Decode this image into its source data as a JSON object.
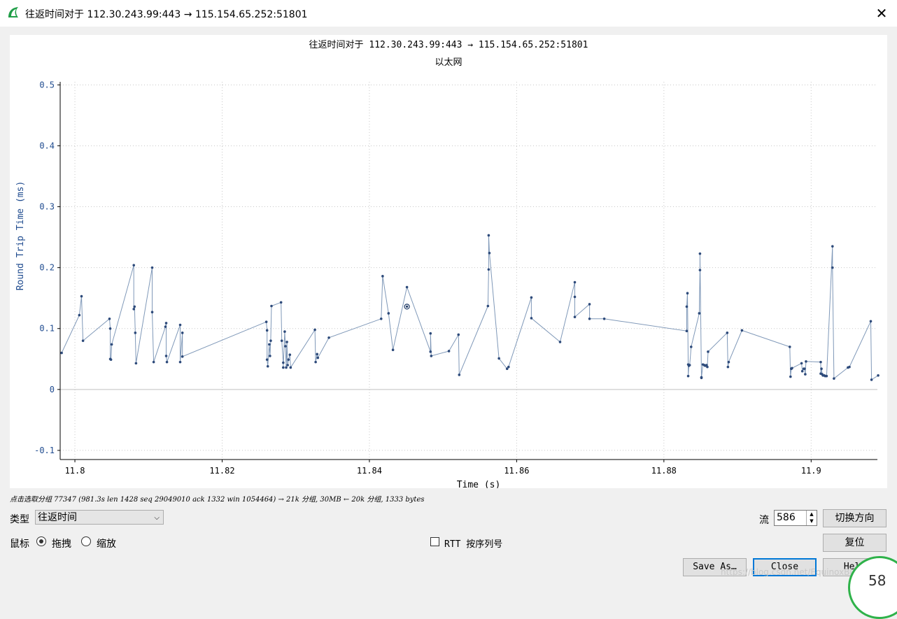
{
  "window": {
    "title": "往返时间对于 112.30.243.99:443 → 115.154.65.252:51801",
    "close_glyph": "✕",
    "icon": "wireshark-fin-icon"
  },
  "chart_data": {
    "type": "scatter",
    "title": "往返时间对于 112.30.243.99:443 → 115.154.65.252:51801",
    "subtitle": "以太网",
    "xlabel": "Time (s)",
    "ylabel": "Round Trip Time (ms)",
    "xlim": [
      11.798,
      11.909
    ],
    "ylim": [
      -0.115,
      0.505
    ],
    "xticks": [
      11.8,
      11.82,
      11.84,
      11.86,
      11.88,
      11.9
    ],
    "xtick_labels": [
      "11.8",
      "11.82",
      "11.84",
      "11.86",
      "11.88",
      "11.9"
    ],
    "yticks": [
      -0.1,
      0,
      0.1,
      0.2,
      0.3,
      0.4,
      0.5
    ],
    "ytick_labels": [
      "-0.1",
      "0",
      "0.1",
      "0.2",
      "0.3",
      "0.4",
      "0.5"
    ],
    "grid": true,
    "line_color": "#7f98b8",
    "marker_color": "#2d4a7a",
    "selected_point": [
      11.8451,
      0.136
    ],
    "points": [
      [
        11.7982,
        0.06
      ],
      [
        11.8006,
        0.122
      ],
      [
        11.8009,
        0.153
      ],
      [
        11.8011,
        0.08
      ],
      [
        11.8047,
        0.116
      ],
      [
        11.8048,
        0.1
      ],
      [
        11.8048,
        0.05
      ],
      [
        11.8049,
        0.049
      ],
      [
        11.805,
        0.074
      ],
      [
        11.808,
        0.204
      ],
      [
        11.808,
        0.132
      ],
      [
        11.8081,
        0.136
      ],
      [
        11.8082,
        0.093
      ],
      [
        11.8083,
        0.043
      ],
      [
        11.8105,
        0.2
      ],
      [
        11.8105,
        0.127
      ],
      [
        11.8107,
        0.045
      ],
      [
        11.8123,
        0.103
      ],
      [
        11.8124,
        0.109
      ],
      [
        11.8124,
        0.055
      ],
      [
        11.8125,
        0.045
      ],
      [
        11.8143,
        0.106
      ],
      [
        11.8143,
        0.045
      ],
      [
        11.8146,
        0.093
      ],
      [
        11.8146,
        0.054
      ],
      [
        11.826,
        0.111
      ],
      [
        11.8261,
        0.097
      ],
      [
        11.8261,
        0.049
      ],
      [
        11.8262,
        0.038
      ],
      [
        11.8264,
        0.074
      ],
      [
        11.8265,
        0.055
      ],
      [
        11.8266,
        0.08
      ],
      [
        11.8267,
        0.137
      ],
      [
        11.828,
        0.143
      ],
      [
        11.8281,
        0.08
      ],
      [
        11.8283,
        0.044
      ],
      [
        11.8283,
        0.036
      ],
      [
        11.8285,
        0.095
      ],
      [
        11.8286,
        0.071
      ],
      [
        11.8287,
        0.036
      ],
      [
        11.8288,
        0.078
      ],
      [
        11.8289,
        0.04
      ],
      [
        11.829,
        0.049
      ],
      [
        11.8292,
        0.057
      ],
      [
        11.8293,
        0.036
      ],
      [
        11.8326,
        0.098
      ],
      [
        11.8327,
        0.045
      ],
      [
        11.8329,
        0.058
      ],
      [
        11.833,
        0.052
      ],
      [
        11.8345,
        0.085
      ],
      [
        11.8416,
        0.116
      ],
      [
        11.8418,
        0.186
      ],
      [
        11.8426,
        0.125
      ],
      [
        11.8432,
        0.065
      ],
      [
        11.8451,
        0.168
      ],
      [
        11.8483,
        0.062
      ],
      [
        11.8483,
        0.092
      ],
      [
        11.8484,
        0.055
      ],
      [
        11.8508,
        0.063
      ],
      [
        11.8521,
        0.09
      ],
      [
        11.8522,
        0.024
      ],
      [
        11.8561,
        0.137
      ],
      [
        11.8562,
        0.197
      ],
      [
        11.8562,
        0.253
      ],
      [
        11.8563,
        0.224
      ],
      [
        11.8576,
        0.051
      ],
      [
        11.8587,
        0.034
      ],
      [
        11.8589,
        0.037
      ],
      [
        11.862,
        0.151
      ],
      [
        11.862,
        0.117
      ],
      [
        11.8659,
        0.078
      ],
      [
        11.8679,
        0.176
      ],
      [
        11.8679,
        0.152
      ],
      [
        11.8679,
        0.119
      ],
      [
        11.8699,
        0.14
      ],
      [
        11.8699,
        0.116
      ],
      [
        11.8719,
        0.116
      ],
      [
        11.8831,
        0.096
      ],
      [
        11.8831,
        0.136
      ],
      [
        11.8832,
        0.158
      ],
      [
        11.8833,
        0.041
      ],
      [
        11.8833,
        0.022
      ],
      [
        11.8834,
        0.039
      ],
      [
        11.8835,
        0.04
      ],
      [
        11.8837,
        0.07
      ],
      [
        11.8848,
        0.125
      ],
      [
        11.8849,
        0.196
      ],
      [
        11.8849,
        0.223
      ],
      [
        11.8851,
        0.02
      ],
      [
        11.8851,
        0.019
      ],
      [
        11.8853,
        0.041
      ],
      [
        11.8855,
        0.04
      ],
      [
        11.8856,
        0.039
      ],
      [
        11.8858,
        0.04
      ],
      [
        11.8859,
        0.037
      ],
      [
        11.886,
        0.062
      ],
      [
        11.8886,
        0.093
      ],
      [
        11.8887,
        0.037
      ],
      [
        11.8888,
        0.045
      ],
      [
        11.8906,
        0.097
      ],
      [
        11.8971,
        0.07
      ],
      [
        11.8972,
        0.021
      ],
      [
        11.8973,
        0.034
      ],
      [
        11.8974,
        0.035
      ],
      [
        11.8987,
        0.043
      ],
      [
        11.8988,
        0.03
      ],
      [
        11.899,
        0.034
      ],
      [
        11.8991,
        0.034
      ],
      [
        11.8992,
        0.025
      ],
      [
        11.8993,
        0.046
      ],
      [
        11.9013,
        0.045
      ],
      [
        11.9013,
        0.026
      ],
      [
        11.9014,
        0.034
      ],
      [
        11.9015,
        0.025
      ],
      [
        11.9016,
        0.023
      ],
      [
        11.9018,
        0.023
      ],
      [
        11.9019,
        0.022
      ],
      [
        11.9021,
        0.022
      ],
      [
        11.9029,
        0.235
      ],
      [
        11.9029,
        0.2
      ],
      [
        11.9031,
        0.018
      ],
      [
        11.905,
        0.036
      ],
      [
        11.9052,
        0.037
      ],
      [
        11.9081,
        0.112
      ],
      [
        11.9082,
        0.016
      ],
      [
        11.9091,
        0.023
      ]
    ]
  },
  "status": {
    "text": "点击选取分组 77347 (981.3s len 1428 seq 29049010 ack 1332 win 1054464) → 21k 分组, 30MB ← 20k 分组, 1333 bytes"
  },
  "controls": {
    "type_label": "类型",
    "type_value": "往返时间",
    "mouse_label": "鼠标",
    "drag_label": "拖拽",
    "zoom_label": "缩放",
    "rtt_checkbox_label": "RTT 按序列号",
    "stream_label": "流",
    "stream_value": "586",
    "switch_direction_label": "切换方向",
    "reset_label": "复位",
    "save_as_label": "Save As…",
    "close_label": "Close",
    "help_label": "Help"
  },
  "watermark": "https://blog.csdn.net/EquinoxBlaze",
  "corner_badge_text": "58"
}
